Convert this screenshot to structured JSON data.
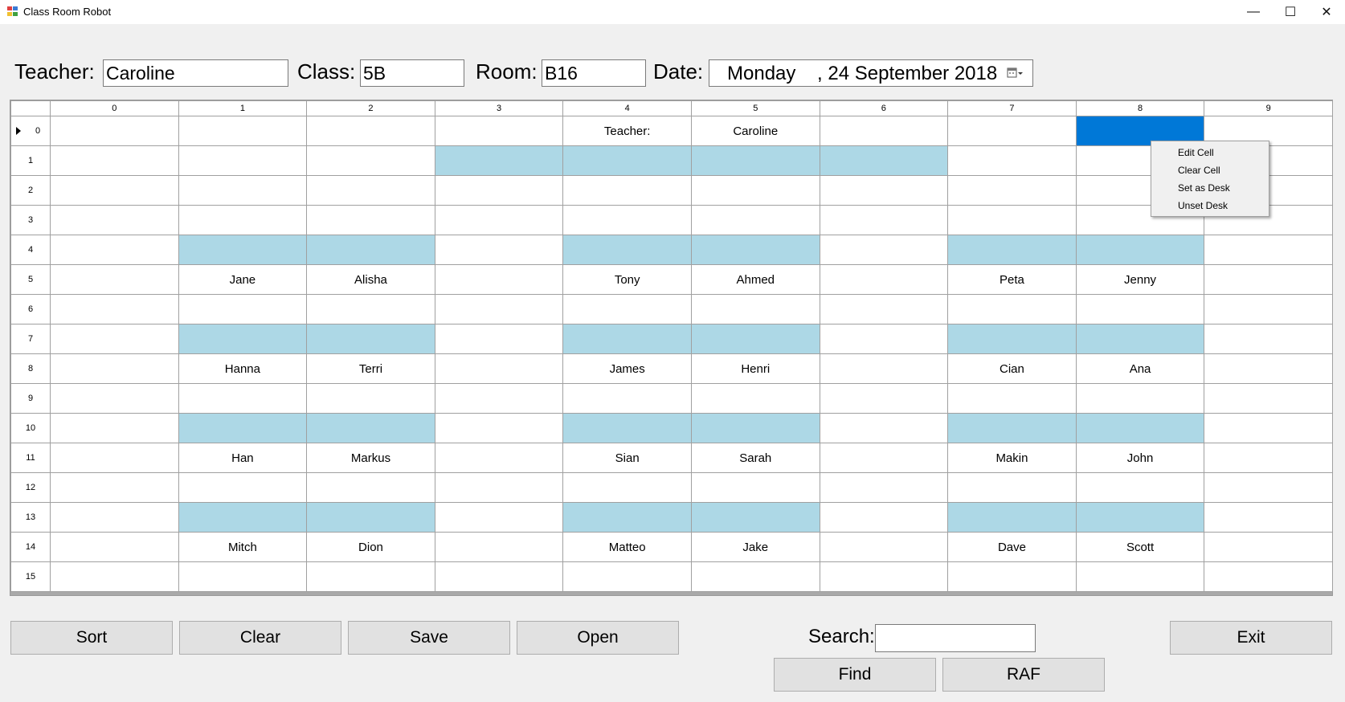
{
  "window": {
    "title": "Class Room Robot",
    "minimize": "—",
    "maximize": "☐",
    "close": "✕"
  },
  "header": {
    "teacher_label": "Teacher:",
    "teacher_value": "Caroline",
    "class_label": "Class:",
    "class_value": "5B",
    "room_label": "Room:",
    "room_value": "B16",
    "date_label": "Date:",
    "date_value": "Monday    , 24 September 2018"
  },
  "grid": {
    "columns": [
      "0",
      "1",
      "2",
      "3",
      "4",
      "5",
      "6",
      "7",
      "8",
      "9"
    ],
    "current_row": 0,
    "selected_cell": {
      "row": 0,
      "col": 8
    },
    "rows": [
      {
        "label": "0",
        "cells": [
          "",
          "",
          "",
          "",
          "Teacher:",
          "Caroline",
          "",
          "",
          "",
          ""
        ],
        "desks": []
      },
      {
        "label": "1",
        "cells": [
          "",
          "",
          "",
          "",
          "",
          "",
          "",
          "",
          "",
          ""
        ],
        "desks": [
          3,
          4,
          5,
          6
        ]
      },
      {
        "label": "2",
        "cells": [
          "",
          "",
          "",
          "",
          "",
          "",
          "",
          "",
          "",
          ""
        ],
        "desks": []
      },
      {
        "label": "3",
        "cells": [
          "",
          "",
          "",
          "",
          "",
          "",
          "",
          "",
          "",
          ""
        ],
        "desks": []
      },
      {
        "label": "4",
        "cells": [
          "",
          "",
          "",
          "",
          "",
          "",
          "",
          "",
          "",
          ""
        ],
        "desks": [
          1,
          2,
          4,
          5,
          7,
          8
        ]
      },
      {
        "label": "5",
        "cells": [
          "",
          "Jane",
          "Alisha",
          "",
          "Tony",
          "Ahmed",
          "",
          "Peta",
          "Jenny",
          ""
        ],
        "desks": []
      },
      {
        "label": "6",
        "cells": [
          "",
          "",
          "",
          "",
          "",
          "",
          "",
          "",
          "",
          ""
        ],
        "desks": []
      },
      {
        "label": "7",
        "cells": [
          "",
          "",
          "",
          "",
          "",
          "",
          "",
          "",
          "",
          ""
        ],
        "desks": [
          1,
          2,
          4,
          5,
          7,
          8
        ]
      },
      {
        "label": "8",
        "cells": [
          "",
          "Hanna",
          "Terri",
          "",
          "James",
          "Henri",
          "",
          "Cian",
          "Ana",
          ""
        ],
        "desks": []
      },
      {
        "label": "9",
        "cells": [
          "",
          "",
          "",
          "",
          "",
          "",
          "",
          "",
          "",
          ""
        ],
        "desks": []
      },
      {
        "label": "10",
        "cells": [
          "",
          "",
          "",
          "",
          "",
          "",
          "",
          "",
          "",
          ""
        ],
        "desks": [
          1,
          2,
          4,
          5,
          7,
          8
        ]
      },
      {
        "label": "11",
        "cells": [
          "",
          "Han",
          "Markus",
          "",
          "Sian",
          "Sarah",
          "",
          "Makin",
          "John",
          ""
        ],
        "desks": []
      },
      {
        "label": "12",
        "cells": [
          "",
          "",
          "",
          "",
          "",
          "",
          "",
          "",
          "",
          ""
        ],
        "desks": []
      },
      {
        "label": "13",
        "cells": [
          "",
          "",
          "",
          "",
          "",
          "",
          "",
          "",
          "",
          ""
        ],
        "desks": [
          1,
          2,
          4,
          5,
          7,
          8
        ]
      },
      {
        "label": "14",
        "cells": [
          "",
          "Mitch",
          "Dion",
          "",
          "Matteo",
          "Jake",
          "",
          "Dave",
          "Scott",
          ""
        ],
        "desks": []
      },
      {
        "label": "15",
        "cells": [
          "",
          "",
          "",
          "",
          "",
          "",
          "",
          "",
          "",
          ""
        ],
        "desks": []
      }
    ]
  },
  "context_menu": {
    "items": [
      "Edit Cell",
      "Clear Cell",
      "Set as Desk",
      "Unset Desk"
    ]
  },
  "buttons": {
    "sort": "Sort",
    "clear": "Clear",
    "save": "Save",
    "open": "Open",
    "find": "Find",
    "raf": "RAF",
    "exit": "Exit"
  },
  "search": {
    "label": "Search:",
    "value": ""
  },
  "colors": {
    "desk": "#add8e6",
    "selected": "#0078d7"
  }
}
